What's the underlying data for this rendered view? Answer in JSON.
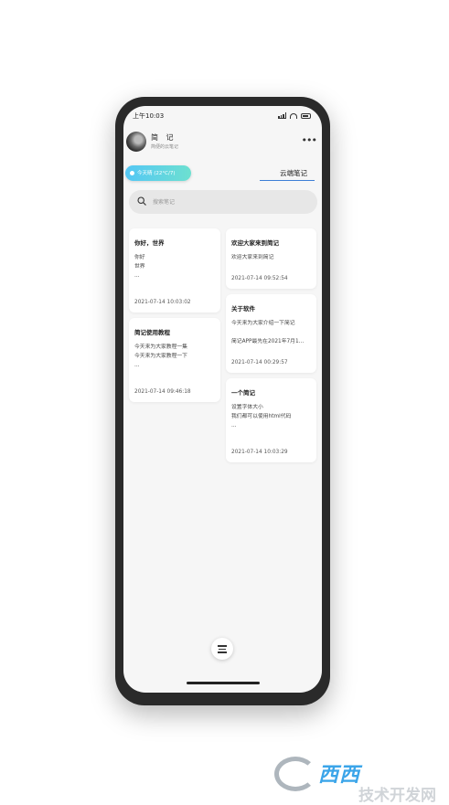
{
  "status_bar": {
    "time": "上午10:03"
  },
  "header": {
    "title": "简 记",
    "subtitle": "简便的云笔记"
  },
  "weather": {
    "text": "今天晴 (22°C/7)"
  },
  "tabs": {
    "cloud_notes": "云端笔记"
  },
  "search": {
    "placeholder": "搜索笔记"
  },
  "notes_left": [
    {
      "title": "你好，世界",
      "body": "你好\n世界\n...",
      "date": "2021-07-14 10:03:02"
    },
    {
      "title": "简记使用教程",
      "body": "今天来为大家教程一集\n今天来为大家教程一下\n...",
      "date": "2021-07-14 09:46:18"
    }
  ],
  "notes_right": [
    {
      "title": "欢迎大家来到简记",
      "body": "欢迎大家来到简记",
      "date": "2021-07-14 09:52:54"
    },
    {
      "title": "关于软件",
      "body": "今天来为大家介绍一下简记\n\n简记APP最先在2021年7月1...",
      "date": "2021-07-14 00:29:57"
    },
    {
      "title": "一个简记",
      "body": "设置字体大小\n我们都可以使用html代码\n...",
      "date": "2021-07-14 10:03:29"
    }
  ],
  "watermark": {
    "brand": "西西",
    "subtitle": "技术开发网"
  },
  "colors": {
    "accent": "#3d7fd6",
    "weather_gradient_start": "#54c7f5",
    "weather_gradient_end": "#6de0d0",
    "watermark_brand": "#1a96e6"
  }
}
